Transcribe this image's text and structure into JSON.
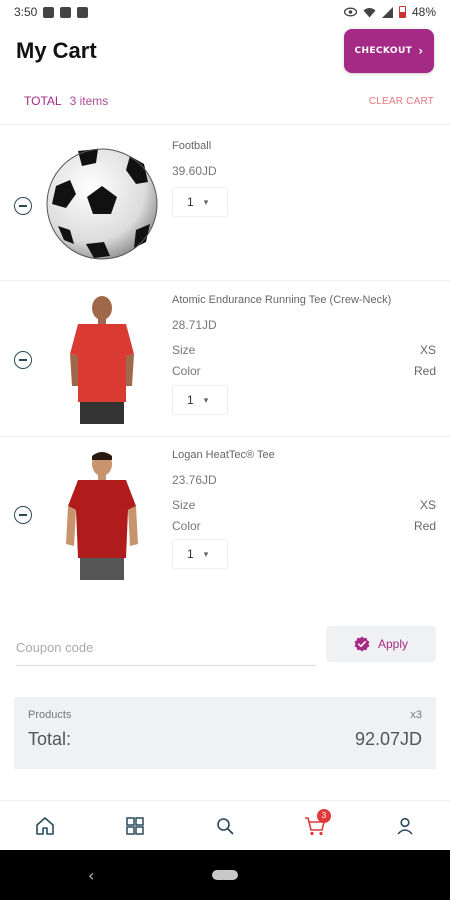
{
  "status_bar": {
    "time": "3:50",
    "battery": "48%"
  },
  "header": {
    "title": "My Cart",
    "checkout_label": "CHECKOUT"
  },
  "summary_row": {
    "total_label": "TOTAL",
    "items_count": "3 items",
    "clear_cart_label": "CLEAR CART"
  },
  "items": [
    {
      "name": "Football",
      "price": "39.60JD",
      "quantity": "1",
      "attributes": []
    },
    {
      "name": "Atomic Endurance Running Tee (Crew-Neck)",
      "price": "28.71JD",
      "quantity": "1",
      "attributes": [
        {
          "label": "Size",
          "value": "XS"
        },
        {
          "label": "Color",
          "value": "Red"
        }
      ]
    },
    {
      "name": "Logan  HeatTec® Tee",
      "price": "23.76JD",
      "quantity": "1",
      "attributes": [
        {
          "label": "Size",
          "value": "XS"
        },
        {
          "label": "Color",
          "value": "Red"
        }
      ]
    }
  ],
  "coupon": {
    "placeholder": "Coupon code",
    "apply_label": "Apply"
  },
  "totals": {
    "products_label": "Products",
    "products_count": "x3",
    "total_label": "Total:",
    "total_amount": "92.07JD"
  },
  "bottom_nav": {
    "cart_badge": "3",
    "items": [
      "home-icon",
      "categories-icon",
      "search-icon",
      "cart-icon",
      "profile-icon"
    ]
  },
  "colors": {
    "accent": "#a52a86",
    "clear_cart": "#e7787d",
    "badge": "#e03a3a"
  }
}
